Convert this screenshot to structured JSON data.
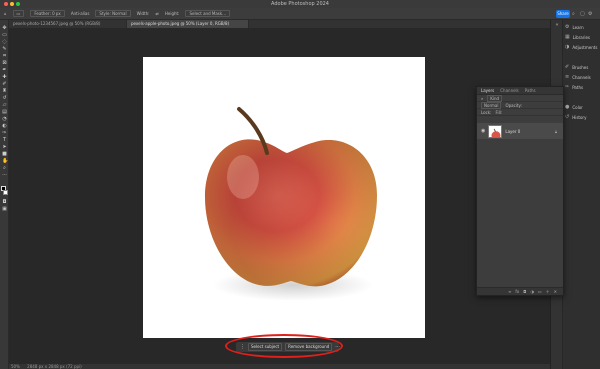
{
  "window": {
    "title": "Adobe Photoshop 2024",
    "traffic_colors": [
      "#ff5f57",
      "#febc2e",
      "#28c840"
    ]
  },
  "options_bar": {
    "items": [
      "⌂",
      "▭",
      "Feather: 0 px",
      "Anti-alias",
      "Style: Normal",
      "Width:",
      "⇄",
      "Height:",
      "Select and Mask..."
    ],
    "share_label": "Share"
  },
  "doc_tabs": [
    {
      "label": "pexels-photo-1234567.jpeg @ 50% (RGB/8)",
      "active": false
    },
    {
      "label": "pexels-apple-photo.jpeg @ 50% (Layer 0, RGB/8)",
      "active": true
    }
  ],
  "contextual_taskbar": {
    "select_subject": "Select subject",
    "remove_background": "Remove background",
    "more": "···"
  },
  "status_bar": {
    "zoom": "50%",
    "info": "2848 px x 2848 px (72 ppi)"
  },
  "right_panel": {
    "items": [
      {
        "icon": "gear-icon",
        "label": "Learn"
      },
      {
        "icon": "swatches-icon",
        "label": "Libraries"
      },
      {
        "icon": "adjust-icon",
        "label": "Adjustments"
      },
      {
        "icon": "brush-icon",
        "label": "Brushes"
      },
      {
        "icon": "channels-icon",
        "label": "Channels"
      },
      {
        "icon": "paths-icon",
        "label": "Paths"
      },
      {
        "icon": "color-icon",
        "label": "Color"
      },
      {
        "icon": "history-icon",
        "label": "History"
      }
    ]
  },
  "layers_panel": {
    "tabs": [
      "Layers",
      "Channels",
      "Paths"
    ],
    "kind_label": "Kind",
    "blend_mode": "Normal",
    "opacity_label": "Opacity:",
    "lock_label": "Lock:",
    "fill_label": "Fill:",
    "layer_name": "Layer 0"
  },
  "colors": {
    "accent": "#1473e6",
    "highlight_ring": "#e0201c"
  }
}
